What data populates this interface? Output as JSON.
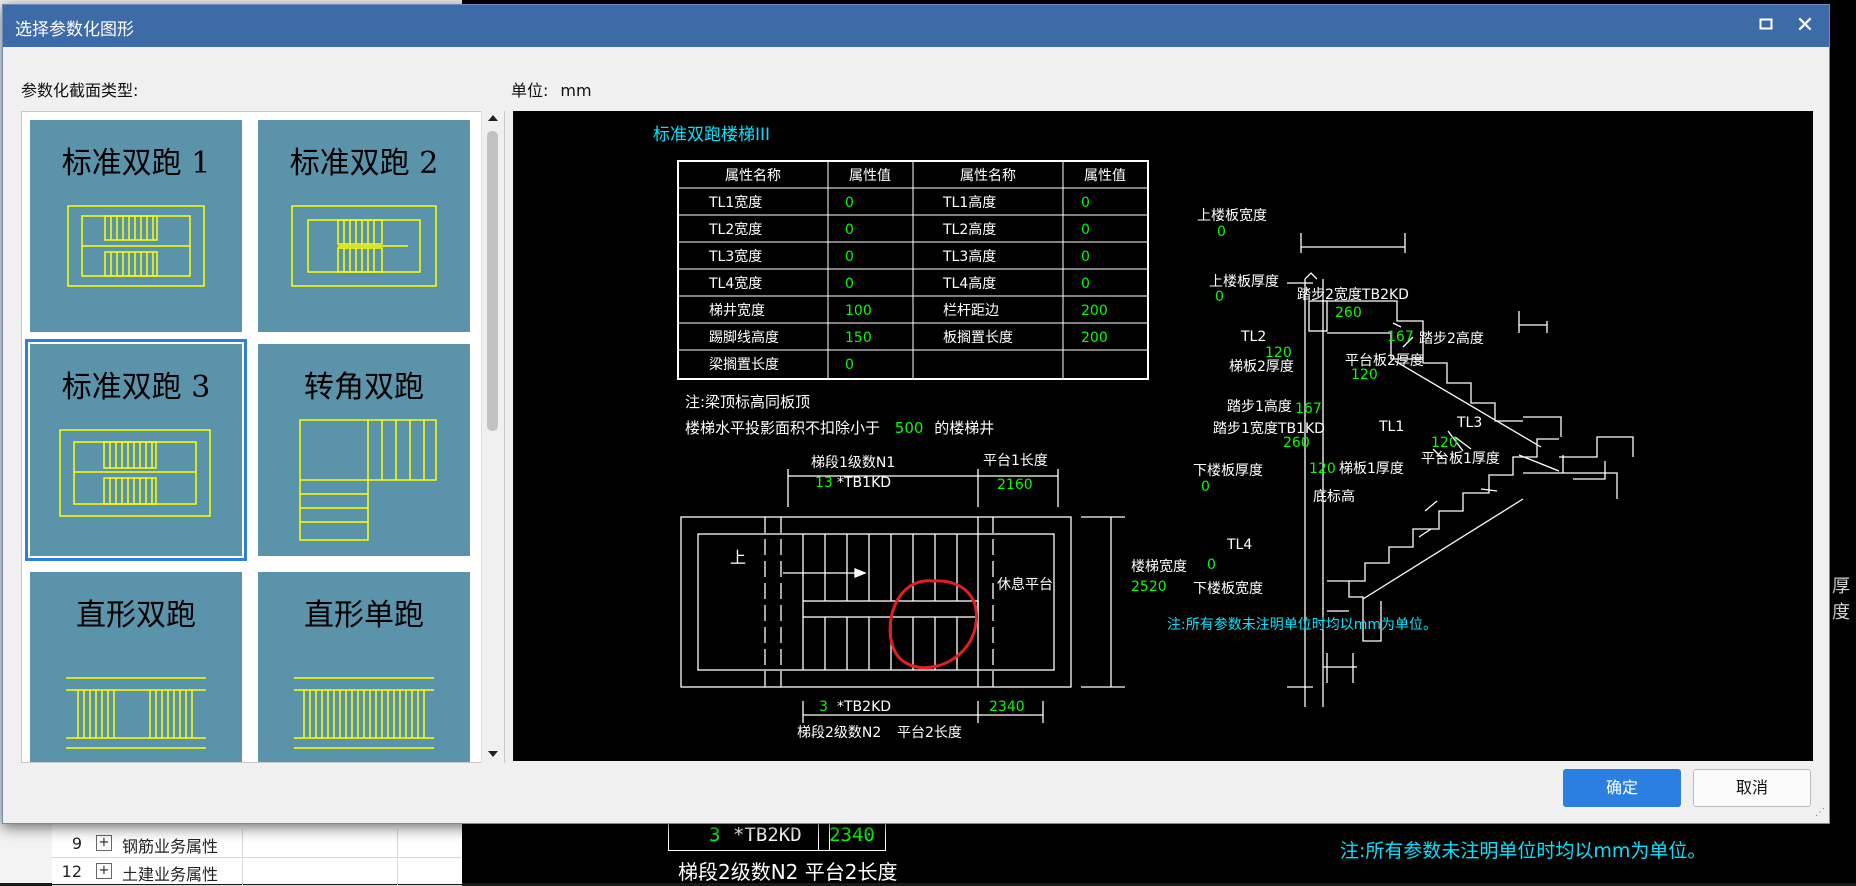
{
  "dialog": {
    "title": "选择参数化图形",
    "type_label": "参数化截面类型:",
    "unit_label": "单位:",
    "unit_value": "mm",
    "ok_label": "确定",
    "cancel_label": "取消",
    "maximize_icon": "maximize-icon",
    "close_icon": "close-icon",
    "accent_color": "#3d6ba8",
    "ok_color": "#2a7fe0"
  },
  "shapes": [
    {
      "label": "标准双跑 1",
      "selected": false
    },
    {
      "label": "标准双跑 2",
      "selected": false
    },
    {
      "label": "标准双跑 3",
      "selected": true
    },
    {
      "label": "转角双跑",
      "selected": false
    },
    {
      "label": "直形双跑",
      "selected": false
    },
    {
      "label": "直形单跑",
      "selected": false
    }
  ],
  "preview": {
    "title": "标准双跑楼梯III",
    "table_headers": [
      "属性名称",
      "属性值",
      "属性名称",
      "属性值"
    ],
    "table_rows": [
      [
        "TL1宽度",
        "0",
        "TL1高度",
        "0"
      ],
      [
        "TL2宽度",
        "0",
        "TL2高度",
        "0"
      ],
      [
        "TL3宽度",
        "0",
        "TL3高度",
        "0"
      ],
      [
        "TL4宽度",
        "0",
        "TL4高度",
        "0"
      ],
      [
        "梯井宽度",
        "100",
        "栏杆距边",
        "200"
      ],
      [
        "踢脚线高度",
        "150",
        "板搁置长度",
        "200"
      ],
      [
        "梁搁置长度",
        "0",
        "",
        ""
      ]
    ],
    "note1": "注:梁顶标高同板顶",
    "note2_a": "楼梯水平投影面积不扣除小于",
    "note2_val": "500",
    "note2_b": "的楼梯井",
    "plan": {
      "n1_label": "梯段1级数N1",
      "n1_val": "13",
      "tb1": "*TB1KD",
      "pt1_label": "平台1长度",
      "pt1_val": "2160",
      "up_label": "上",
      "rest_label": "休息平台",
      "width_label": "楼梯宽度",
      "width_val": "2520",
      "n2_val": "3",
      "tb2": "*TB2KD",
      "pt2_val": "2340",
      "n2_label": "梯段2级数N2",
      "pt2_label": "平台2长度"
    },
    "section": {
      "top_width_label": "上楼板宽度",
      "top_width_val": "0",
      "top_thick_label": "上楼板厚度",
      "top_thick_val": "0",
      "step2w_label": "踏步2宽度TB2KD",
      "step2w_val": "260",
      "step2h_val": "167",
      "step2h_label": "踏步2高度",
      "tl2": "TL2",
      "slab2_val": "120",
      "slab2_label": "梯板2厚度",
      "plat2_label": "平台板2厚度",
      "plat2_val": "120",
      "step1h_label": "踏步1高度",
      "step1h_val": "167",
      "step1w_label": "踏步1宽度TB1KD",
      "step1w_val": "260",
      "tl1": "TL1",
      "tl3": "TL3",
      "plat1_val": "120",
      "plat1_label": "平台板1厚度",
      "slab1_val": "120",
      "slab1_label": "梯板1厚度",
      "bot_thick_label": "下楼板厚度",
      "bot_thick_val": "0",
      "base_label": "底标高",
      "tl4": "TL4",
      "bot_width_val": "0",
      "bot_width_label": "下楼板宽度"
    },
    "footnote": "注:所有参数未注明单位时均以mm为单位。"
  },
  "background": {
    "rows": [
      {
        "num": "9",
        "label": "钢筋业务属性"
      },
      {
        "num": "12",
        "label": "土建业务属性"
      }
    ],
    "cad_n2": "3",
    "cad_tb2": "*TB2KD",
    "cad_pt2": "2340",
    "cad_label": "梯段2级数N2  平台2长度",
    "cad_note": "注:所有参数未注明单位时均以mm为单位。",
    "thick_text": "厚度"
  }
}
